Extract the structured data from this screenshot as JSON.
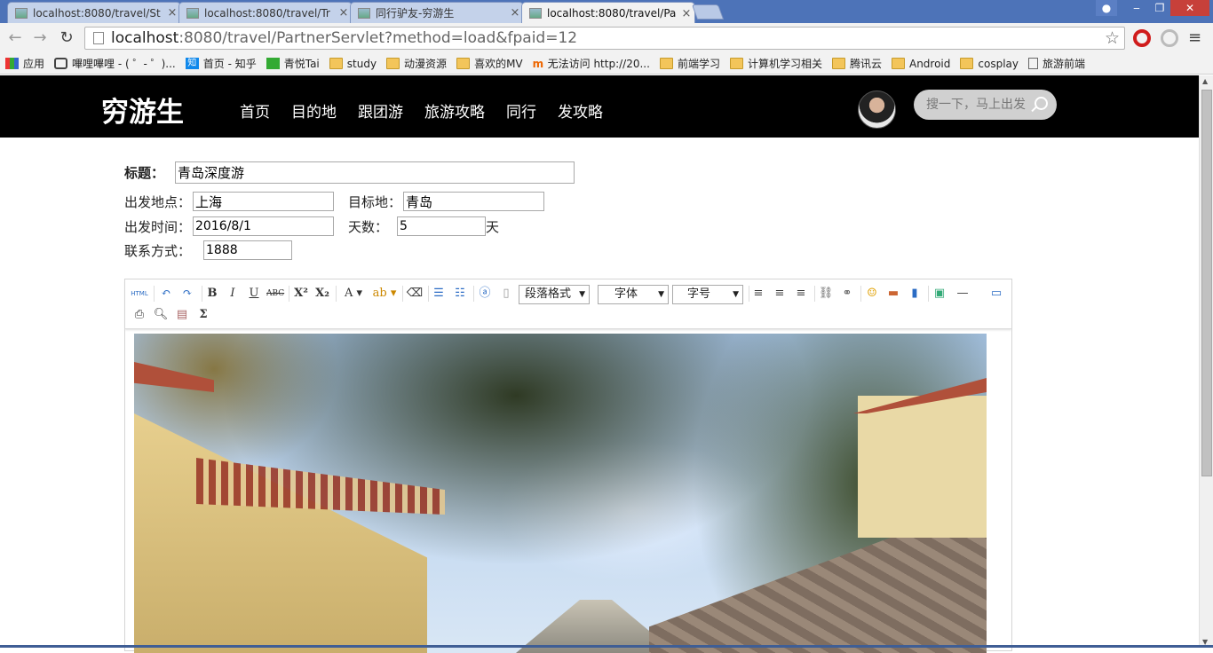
{
  "browser": {
    "tabs": [
      {
        "title": "localhost:8080/travel/St",
        "close": "×"
      },
      {
        "title": "localhost:8080/travel/Tr",
        "close": "×"
      },
      {
        "title": "同行驴友-穷游生",
        "close": "×"
      },
      {
        "title": "localhost:8080/travel/Pa",
        "close": "×"
      }
    ],
    "active_tab": 3,
    "url_host": "localhost",
    "url_rest": ":8080/travel/PartnerServlet?method=load&fpaid=12",
    "bookmarks": [
      {
        "label": "应用",
        "icon": "apps-grid-icon"
      },
      {
        "label": "嗶哩嗶哩 - ( ゜- ゜)...",
        "icon": "bilibili-icon"
      },
      {
        "label": "首页 - 知乎",
        "icon": "zhihu-icon"
      },
      {
        "label": "青悦Tai",
        "icon": "tai-icon"
      },
      {
        "label": "study",
        "icon": "folder-icon"
      },
      {
        "label": "动漫资源",
        "icon": "folder-icon"
      },
      {
        "label": "喜欢的MV",
        "icon": "folder-icon"
      },
      {
        "label": "无法访问 http://20...",
        "icon": "mi-icon"
      },
      {
        "label": "前端学习",
        "icon": "folder-icon"
      },
      {
        "label": "计算机学习相关",
        "icon": "folder-icon"
      },
      {
        "label": "腾讯云",
        "icon": "folder-icon"
      },
      {
        "label": "Android",
        "icon": "folder-icon"
      },
      {
        "label": "cosplay",
        "icon": "folder-icon"
      },
      {
        "label": "旅游前端",
        "icon": "document-icon"
      }
    ]
  },
  "site": {
    "logo": "穷游生",
    "nav": [
      "首页",
      "目的地",
      "跟团游",
      "旅游攻略",
      "同行",
      "发攻略"
    ],
    "search_placeholder": "搜一下，马上出发"
  },
  "form": {
    "title_label": "标题：",
    "title_value": "青岛深度游",
    "from_label": "出发地点：",
    "from_value": "上海",
    "dest_label": "目标地：",
    "dest_value": "青岛",
    "time_label": "出发时间：",
    "time_value": "2016/8/1",
    "days_label": "天数：",
    "days_value": "5",
    "days_unit": "天",
    "contact_label": "联系方式：",
    "contact_value": "1888"
  },
  "editor": {
    "html_label": "HTML",
    "paragraph_select": "段落格式",
    "font_select": "字体",
    "size_select": "字号"
  }
}
